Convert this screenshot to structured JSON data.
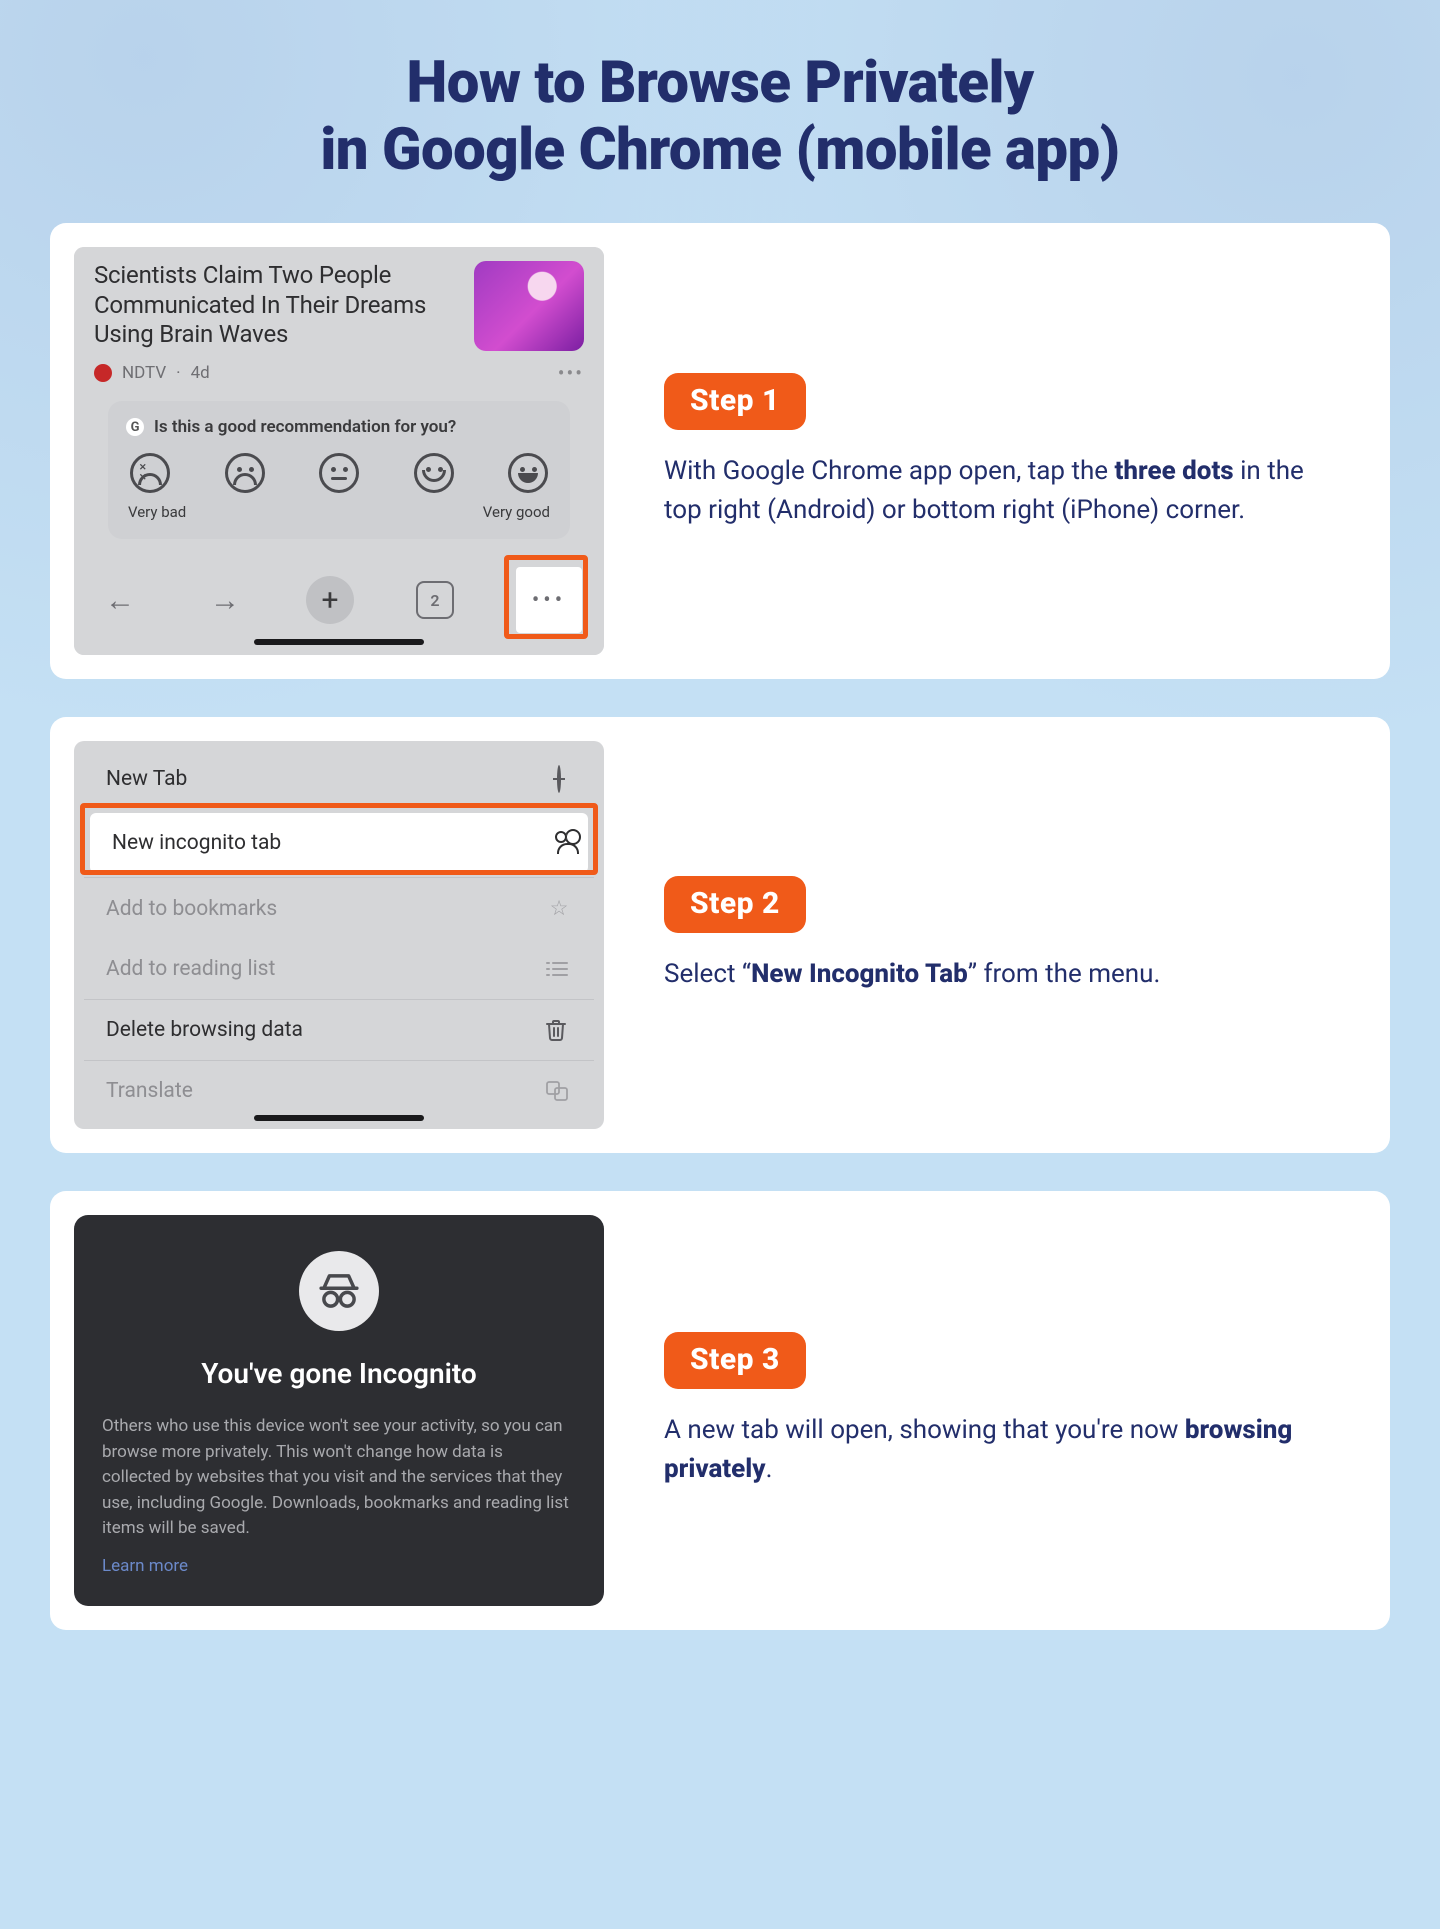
{
  "title_line1": "How to Browse Privately",
  "title_line2": "in Google Chrome (mobile app)",
  "steps": [
    {
      "badge": "Step 1",
      "desc_pre": "With Google Chrome app open, tap the ",
      "desc_bold": "three dots",
      "desc_post": " in the top right (Android) or bottom right (iPhone) corner."
    },
    {
      "badge": "Step 2",
      "desc_pre": "Select “",
      "desc_bold": "New Incognito Tab",
      "desc_post": "” from the menu."
    },
    {
      "badge": "Step 3",
      "desc_pre": "A new tab will open, showing that you're now ",
      "desc_bold": "browsing privately",
      "desc_post": "."
    }
  ],
  "shot1": {
    "headline": "Scientists Claim Two People Communicated In Their Dreams Using Brain Waves",
    "source": "NDTV",
    "age": "4d",
    "question": "Is this a good recommendation for you?",
    "label_bad": "Very bad",
    "label_good": "Very good",
    "tabcount": "2"
  },
  "shot2": {
    "items": {
      "new_tab": "New Tab",
      "incognito": "New incognito tab",
      "bookmarks": "Add to bookmarks",
      "reading": "Add to reading list",
      "delete": "Delete browsing data",
      "translate": "Translate"
    }
  },
  "shot3": {
    "heading": "You've gone Incognito",
    "body": "Others who use this device won't see your activity, so you can browse more privately. This won't change how data is collected by websites that you visit and the services that they use, including Google. Downloads, bookmarks and reading list items will be saved.",
    "learn": "Learn more"
  }
}
